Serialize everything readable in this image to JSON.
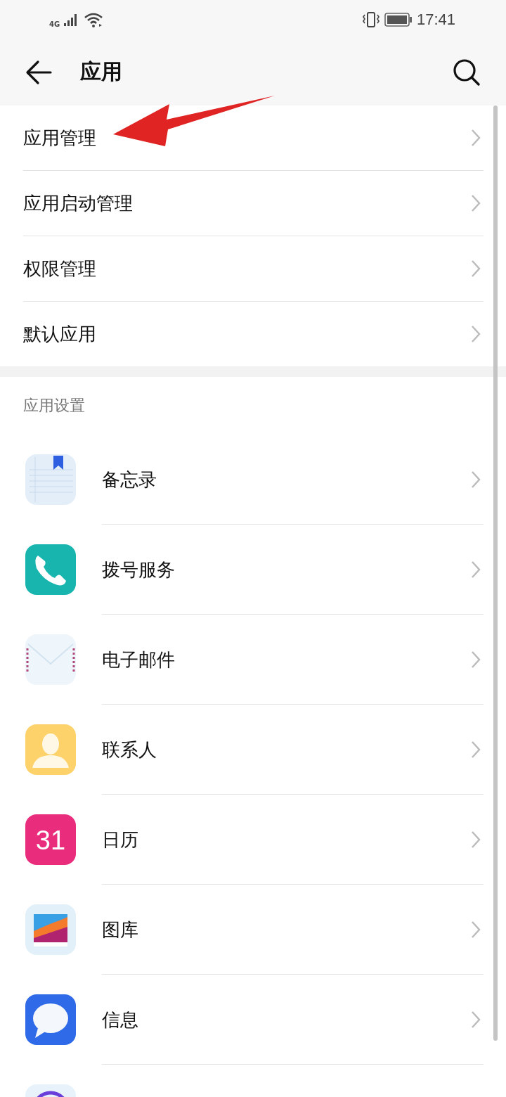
{
  "status_bar": {
    "network": "4G",
    "time": "17:41"
  },
  "header": {
    "title": "应用"
  },
  "menu": [
    {
      "label": "应用管理",
      "highlighted": true
    },
    {
      "label": "应用启动管理",
      "highlighted": false
    },
    {
      "label": "权限管理",
      "highlighted": false
    },
    {
      "label": "默认应用",
      "highlighted": false
    }
  ],
  "section": {
    "title": "应用设置"
  },
  "apps": [
    {
      "kind": "notes",
      "label": "备忘录"
    },
    {
      "kind": "phone",
      "label": "拨号服务"
    },
    {
      "kind": "mail",
      "label": "电子邮件"
    },
    {
      "kind": "contacts",
      "label": "联系人"
    },
    {
      "kind": "calendar",
      "label": "日历",
      "icon_text": "31"
    },
    {
      "kind": "gallery",
      "label": "图库"
    },
    {
      "kind": "messages",
      "label": "信息"
    },
    {
      "kind": "partial"
    }
  ]
}
